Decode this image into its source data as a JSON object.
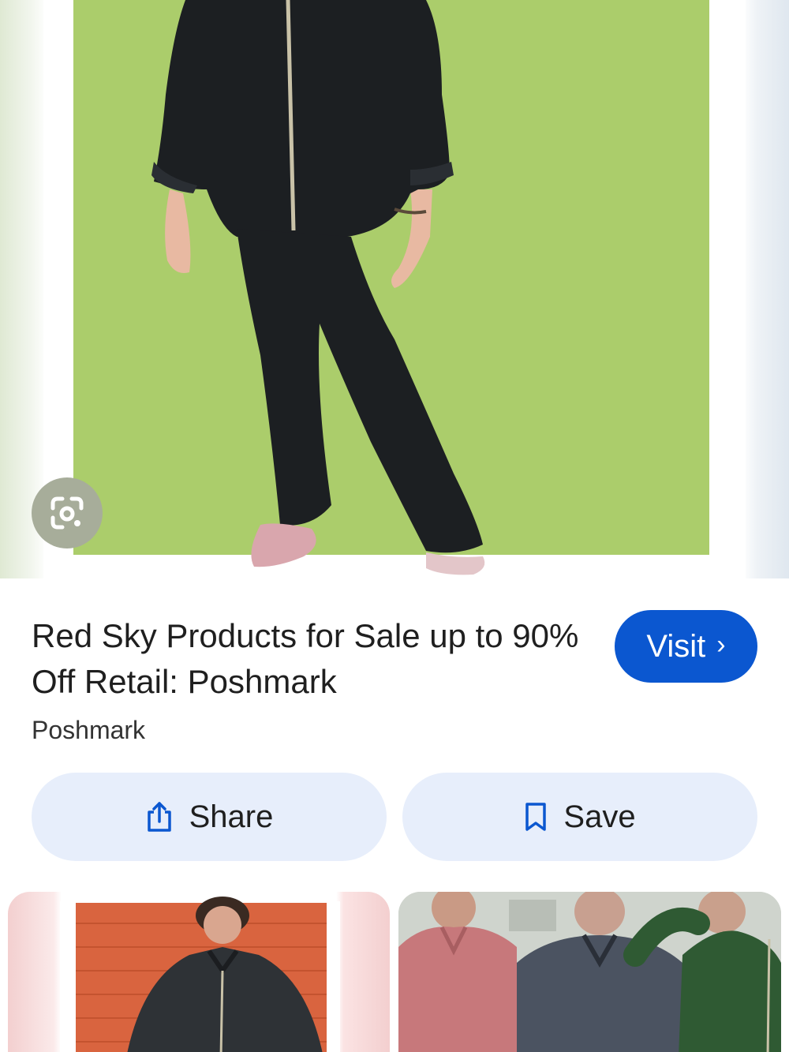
{
  "hero": {
    "image_alt": "Person wearing a black zip-front long-sleeve jumpsuit on a green background",
    "lens_icon": "google-lens-icon"
  },
  "result": {
    "title": "Red Sky Products for Sale up to 90% Off Retail: Poshmark",
    "source": "Poshmark",
    "visit_label": "Visit",
    "visit_chevron": "›"
  },
  "actions": {
    "share_label": "Share",
    "save_label": "Save",
    "share_icon": "share-icon",
    "save_icon": "bookmark-icon"
  },
  "thumbnails": [
    {
      "alt": "Person in dark jumpsuit in front of orange brick wall"
    },
    {
      "alt": "Three people wearing pink, grey and green jumpsuits"
    }
  ],
  "colors": {
    "accent": "#0b57d0",
    "action_bg": "#e7eefb",
    "hero_green": "#abcd6b",
    "lens_bg": "#a7ad9a"
  }
}
